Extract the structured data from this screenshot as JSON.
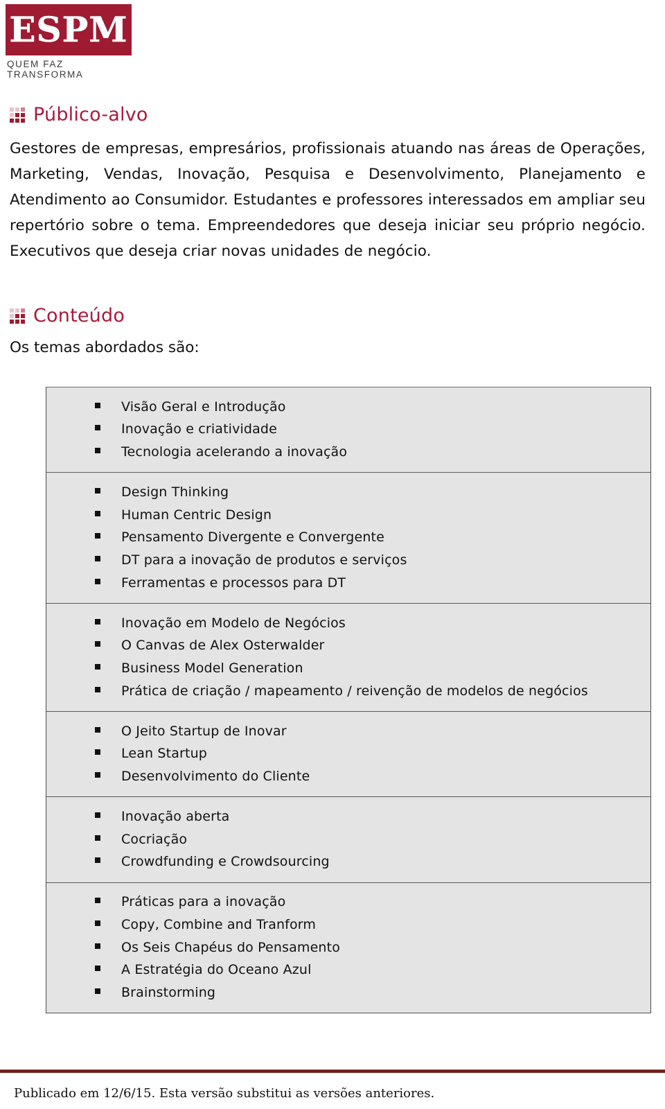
{
  "logo": {
    "wordmark": "ESPM",
    "tagline": "QUEM FAZ TRANSFORMA",
    "brand_color": "#9E1B32"
  },
  "sections": {
    "publico_alvo": {
      "heading": "Público-alvo",
      "icon": "dot-grid-icon",
      "paragraph": "Gestores de empresas, empresários, profissionais atuando nas áreas de Operações, Marketing, Vendas, Inovação, Pesquisa e Desenvolvimento, Planejamento e Atendimento ao Consumidor. Estudantes e professores interessados em ampliar seu repertório sobre o tema. Empreendedores que deseja iniciar seu próprio negócio. Executivos que deseja criar novas unidades de negócio."
    },
    "conteudo": {
      "heading": "Conteúdo",
      "icon": "dot-grid-icon",
      "lead": "Os temas abordados são:",
      "topic_groups": [
        {
          "items": [
            "Visão Geral e Introdução",
            "Inovação e criatividade",
            "Tecnologia acelerando a inovação"
          ]
        },
        {
          "items": [
            "Design Thinking",
            "Human Centric Design",
            "Pensamento Divergente e Convergente",
            "DT para a inovação de produtos e serviços",
            "Ferramentas e processos para DT"
          ]
        },
        {
          "items": [
            "Inovação em Modelo de Negócios",
            "O Canvas de Alex Osterwalder",
            "Business Model Generation",
            "Prática de criação / mapeamento / reivenção de modelos de negócios"
          ]
        },
        {
          "items": [
            "O Jeito Startup de Inovar",
            "Lean Startup",
            "Desenvolvimento do Cliente"
          ]
        },
        {
          "items": [
            "Inovação aberta",
            "Cocriação",
            "Crowdfunding e Crowdsourcing"
          ]
        },
        {
          "items": [
            "Práticas para a inovação",
            "Copy, Combine and Tranform",
            "Os Seis Chapéus do Pensamento",
            "A Estratégia do Oceano Azul",
            "Brainstorming"
          ]
        }
      ]
    }
  },
  "footer": {
    "note": "Publicado em 12/6/15. Esta versão substitui as versões anteriores.",
    "rule_color": "#6E1D1D"
  }
}
